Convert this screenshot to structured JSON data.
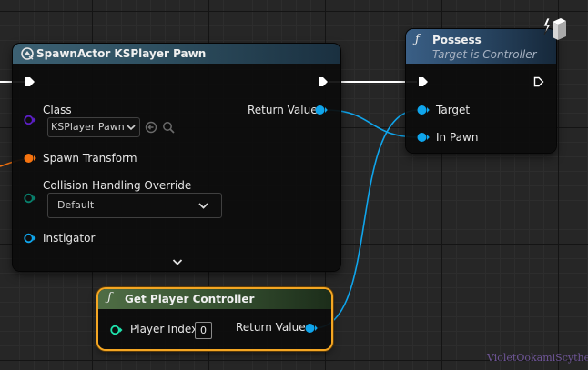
{
  "spawn_node": {
    "title": "SpawnActor KSPlayer Pawn",
    "class_label": "Class",
    "class_value": "KSPlayer Pawn",
    "spawn_transform_label": "Spawn Transform",
    "collision_label": "Collision Handling Override",
    "collision_value": "Default",
    "instigator_label": "Instigator",
    "return_label": "Return Value"
  },
  "possess_node": {
    "title": "Possess",
    "subtitle": "Target is Controller",
    "target_label": "Target",
    "in_pawn_label": "In Pawn"
  },
  "get_pc_node": {
    "title": "Get Player Controller",
    "player_index_label": "Player Index",
    "player_index_value": "0",
    "return_label": "Return Value"
  },
  "watermark": "VioletOokamiScythe",
  "colors": {
    "exec": "#ffffff",
    "object_pin": "#0fa5ec",
    "class_pin": "#5b1fc4",
    "transform_pin": "#f5730f",
    "byte_pin": "#087f6c",
    "int_pin": "#1fe3ad",
    "selection": "#f4a623"
  }
}
